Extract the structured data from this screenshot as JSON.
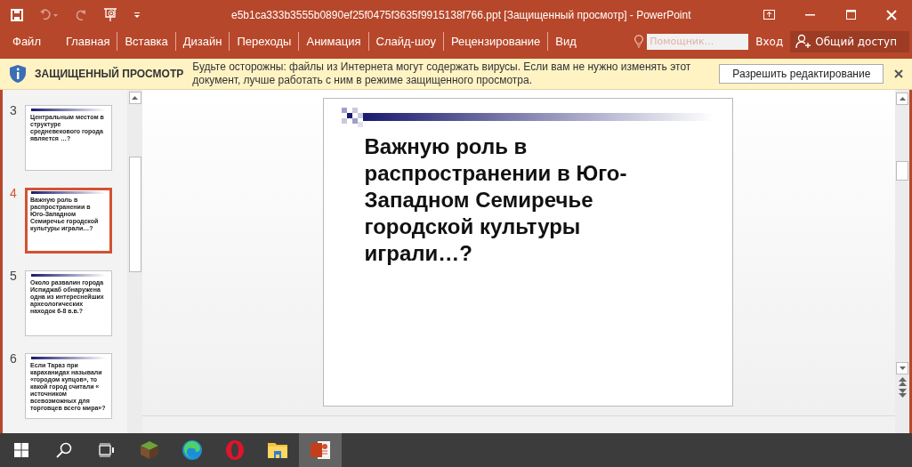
{
  "window": {
    "title": "e5b1ca333b3555b0890ef25f0475f3635f9915138f766.ppt [Защищенный просмотр] - PowerPoint"
  },
  "ribbon": {
    "tabs": [
      {
        "label": "Файл",
        "selected": false
      },
      {
        "label": "Главная",
        "selected": false
      },
      {
        "label": "Вставка",
        "selected": false
      },
      {
        "label": "Дизайн",
        "selected": false
      },
      {
        "label": "Переходы",
        "selected": false
      },
      {
        "label": "Анимация",
        "selected": false
      },
      {
        "label": "Слайд-шоу",
        "selected": false
      },
      {
        "label": "Рецензирование",
        "selected": false
      },
      {
        "label": "Вид",
        "selected": false
      }
    ],
    "search": {
      "placeholder": "Помощник..."
    },
    "sign_in": "Вход",
    "share": "Общий доступ"
  },
  "protected_view": {
    "title": "ЗАЩИЩЕННЫЙ ПРОСМОТР",
    "message": "Будьте осторожны: файлы из Интернета могут содержать вирусы. Если вам не нужно изменять этот документ, лучше работать с ним в режиме защищенного просмотра.",
    "button": "Разрешить редактирование"
  },
  "thumbnails": [
    {
      "number": "3",
      "text": "Центральным местом в структуре средневекового города является …?",
      "selected": false
    },
    {
      "number": "4",
      "text": "Важную роль в распространении в Юго-Западном Семиречье городской культуры играли…?",
      "selected": true
    },
    {
      "number": "5",
      "text": "Около развалин города Испиджаб обнаружена одна из интереснейших археологических находок 6-8 в.в.?",
      "selected": false
    },
    {
      "number": "6",
      "text": "Если Тараз при караханидах называли «городом купцов», то какой город считали « источником всевозможных для торговцев всего мира»?",
      "selected": false
    }
  ],
  "slide": {
    "title": "Важную роль в распространении в Юго-Западном Семиречье городской культуры играли…?"
  },
  "taskbar": [
    {
      "kind": "start",
      "selected": false
    },
    {
      "kind": "search",
      "selected": false
    },
    {
      "kind": "taskview",
      "selected": false
    },
    {
      "kind": "minecraft",
      "selected": false
    },
    {
      "kind": "edge",
      "selected": false
    },
    {
      "kind": "opera",
      "selected": false
    },
    {
      "kind": "explorer",
      "selected": false
    },
    {
      "kind": "powerpoint",
      "selected": true
    }
  ]
}
